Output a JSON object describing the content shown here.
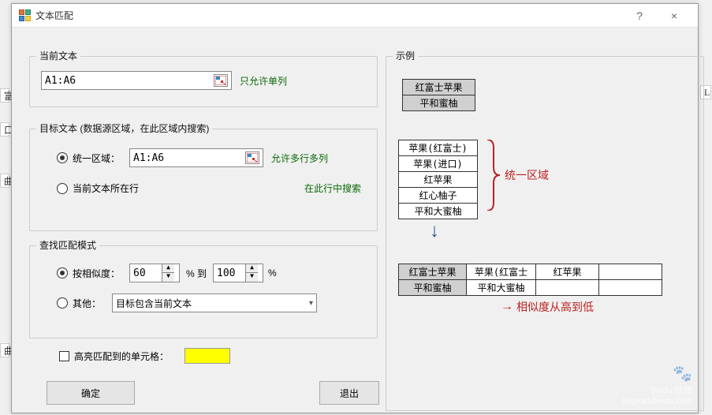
{
  "window": {
    "title": "文本匹配",
    "help": "?",
    "close": "×"
  },
  "current": {
    "legend": "当前文本",
    "value": "A1:A6",
    "hint": "只允许单列"
  },
  "target": {
    "legend": "目标文本  (数据源区域，在此区域内搜索)",
    "radio_unified": "统一区域：",
    "unified_value": "A1:A6",
    "unified_hint": "允许多行多列",
    "radio_row": "当前文本所在行",
    "row_hint": "在此行中搜索"
  },
  "mode": {
    "legend": "查找匹配模式",
    "radio_sim": "按相似度：",
    "sim_from": "60",
    "sim_to_label": "%  到",
    "sim_to": "100",
    "pct": "%",
    "radio_other": "其他：",
    "other_value": "目标包含当前文本"
  },
  "highlight": {
    "label": "高亮匹配到的单元格："
  },
  "buttons": {
    "ok": "确定",
    "exit": "退出"
  },
  "example": {
    "legend": "示例",
    "top": [
      "红富士苹果",
      "平和蜜柚"
    ],
    "mid": [
      "苹果(红富士)",
      "苹果(进口)",
      "红苹果",
      "红心柚子",
      "平和大蜜柚"
    ],
    "brace_label": "统一区域",
    "bot": [
      [
        "红富士苹果",
        "苹果(红富士",
        "红苹果",
        ""
      ],
      [
        "平和蜜柚",
        "平和大蜜柚",
        "",
        ""
      ]
    ],
    "arrow_label": "相似度从高到低"
  },
  "watermark": {
    "brand": "Baidu 经验",
    "url": "jingyan.baidu.com"
  }
}
